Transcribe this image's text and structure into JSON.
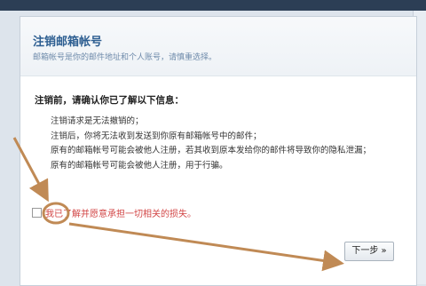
{
  "page": {
    "title": "注销邮箱帐号",
    "subtitle": "邮箱帐号是你的邮件地址和个人账号，请慎重选择。"
  },
  "confirm": {
    "heading": "注销前，请确认你已了解以下信息：",
    "items": [
      "注销请求是无法撤销的；",
      "注销后，你将无法收到发送到你原有邮箱帐号中的邮件；",
      "原有的邮箱帐号可能会被他人注册，若其收到原本发给你的邮件将导致你的隐私泄漏；",
      "原有的邮箱帐号可能会被他人注册，用于行骗。"
    ]
  },
  "agree": {
    "label": "我已了解并愿意承担一切相关的损失。",
    "checked": false
  },
  "actions": {
    "next_label": "下一步 »"
  },
  "colors": {
    "title": "#2d5e91",
    "warning_text": "#d24545",
    "annotation": "#c08a55"
  },
  "icons": {
    "annotation_arrow": "annotation-arrow-icon",
    "annotation_circle": "annotation-circle-icon"
  }
}
